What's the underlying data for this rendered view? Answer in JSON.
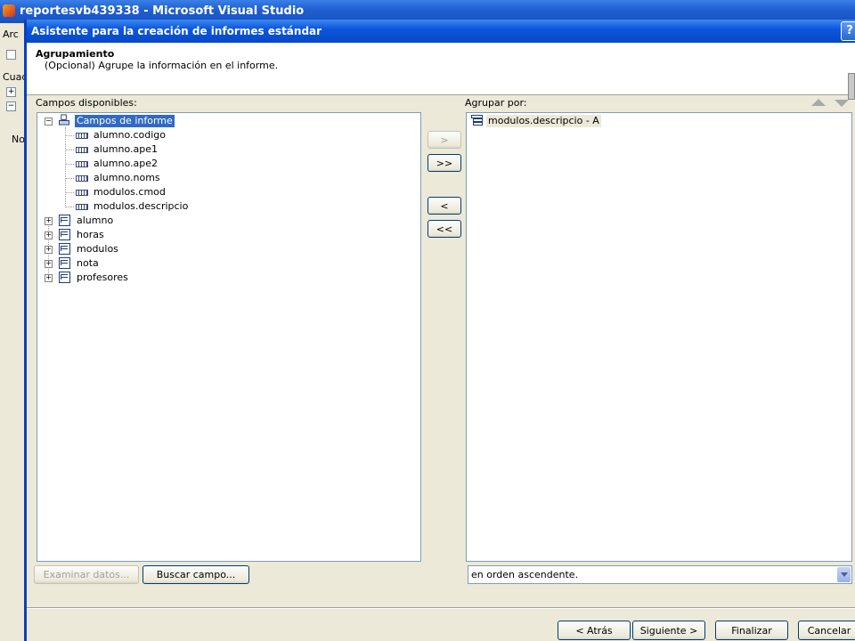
{
  "vs": {
    "title": "reportesvb439338 - Microsoft Visual Studio",
    "side_menu": "Arc",
    "side_tab": "Cuad",
    "side_text": "No"
  },
  "dialog": {
    "title": "Asistente para la creación de informes estándar",
    "help": "?",
    "header_title": "Agrupamiento",
    "header_subtitle": "(Opcional) Agrupe la información en el informe.",
    "available_label": "Campos disponibles:",
    "group_label": "Agrupar por:",
    "tree": {
      "root": "Campos de informe",
      "root_fields": [
        "alumno.codigo",
        "alumno.ape1",
        "alumno.ape2",
        "alumno.noms",
        "modulos.cmod",
        "modulos.descripcio"
      ],
      "tables": [
        "alumno",
        "horas",
        "modulos",
        "nota",
        "profesores"
      ]
    },
    "group_items": [
      "modulos.descripcio - A"
    ],
    "buttons": {
      "add_one": ">",
      "add_all": ">>",
      "remove_one": "<",
      "remove_all": "<<",
      "browse": "Examinar datos...",
      "find": "Buscar campo...",
      "back": "< Atrás",
      "next": "Siguiente >",
      "finish": "Finalizar",
      "cancel": "Cancelar"
    },
    "sort_value": "en orden ascendente."
  }
}
